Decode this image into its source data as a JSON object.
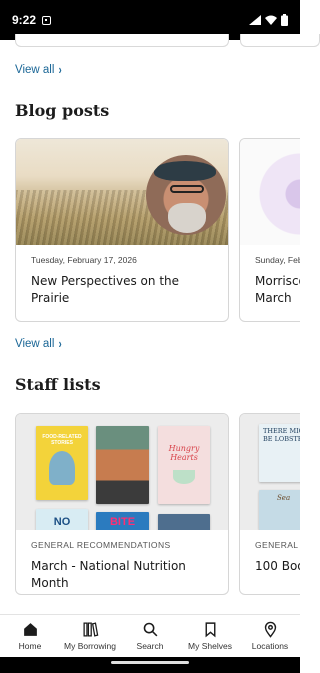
{
  "status_bar": {
    "time": "9:22"
  },
  "sections": {
    "top": {
      "view_all": "View all"
    },
    "blog": {
      "title": "Blog posts",
      "view_all": "View all",
      "cards": [
        {
          "meta": "Tuesday, February 17, 2026",
          "title": "New Perspectives on the Prairie"
        },
        {
          "meta": "Sunday, Feb",
          "title": "Morrisco\nMarch"
        }
      ]
    },
    "staff": {
      "title": "Staff lists",
      "cards": [
        {
          "category": "GENERAL RECOMMENDATIONS",
          "title": "March - National Nutrition Month",
          "books": [
            "FOOD-RELATED STORIES",
            "Hungry Hearts",
            "NO",
            "BITE"
          ]
        },
        {
          "category": "GENERAL R",
          "title": "100 Boo",
          "books": [
            "THERE MIGHT BE LOBSTE",
            "Sea"
          ]
        }
      ]
    }
  },
  "bottom_nav": [
    {
      "label": "Home",
      "icon": "home-icon",
      "active": true
    },
    {
      "label": "My Borrowing",
      "icon": "books-icon",
      "active": false
    },
    {
      "label": "Search",
      "icon": "search-icon",
      "active": false
    },
    {
      "label": "My Shelves",
      "icon": "bookmark-icon",
      "active": false
    },
    {
      "label": "Locations",
      "icon": "location-pin-icon",
      "active": false
    }
  ],
  "colors": {
    "link": "#1a6696",
    "accent_text": "#1c1c1c"
  }
}
